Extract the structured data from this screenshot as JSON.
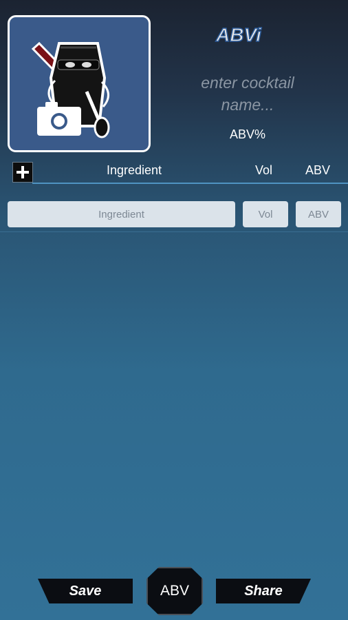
{
  "app": {
    "logo_text": "ABVi"
  },
  "cocktail": {
    "name_placeholder": "enter cocktail name...",
    "abv_label": "ABV%"
  },
  "table_header": {
    "ingredient": "Ingredient",
    "vol": "Vol",
    "abv": "ABV"
  },
  "row": {
    "ingredient_placeholder": "Ingredient",
    "vol_placeholder": "Vol",
    "abv_placeholder": "ABV"
  },
  "bottom_bar": {
    "save": "Save",
    "abv": "ABV",
    "share": "Share"
  },
  "icons": {
    "photo": "shaker-camera-icon",
    "add": "plus-icon"
  }
}
